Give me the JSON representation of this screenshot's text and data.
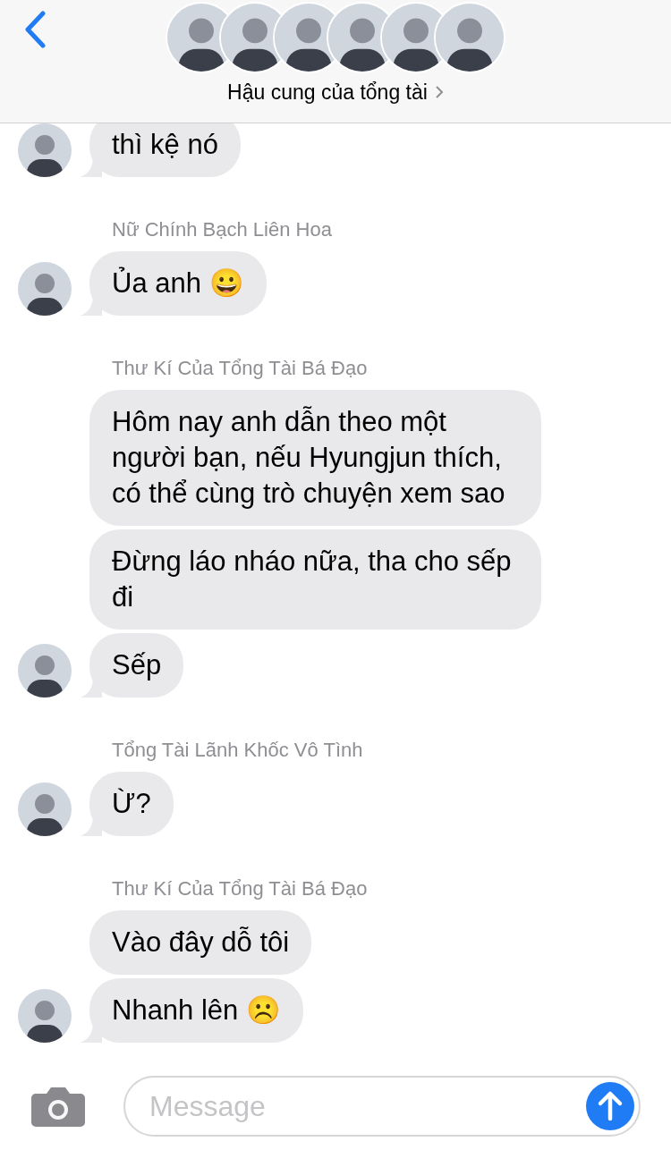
{
  "header": {
    "title": "Hậu cung của tổng tài"
  },
  "messages": [
    {
      "text": "thì kệ nó",
      "show_avatar": true
    },
    {
      "sender": "Nữ Chính Bạch Liên Hoa",
      "text": "Ủa anh 😀",
      "show_avatar": true
    },
    {
      "sender": "Thư Kí Của Tổng Tài Bá Đạo",
      "text": "Hôm nay anh dẫn theo một người bạn, nếu Hyungjun thích, có thể cùng trò chuyện xem sao",
      "show_avatar": false
    },
    {
      "text": "Đừng láo nháo nữa, tha cho sếp đi",
      "show_avatar": false
    },
    {
      "text": "Sếp",
      "show_avatar": true
    },
    {
      "sender": "Tổng Tài Lãnh Khốc Vô Tình",
      "text": "Ừ?",
      "show_avatar": true
    },
    {
      "sender": "Thư Kí Của Tổng Tài Bá Đạo",
      "text": "Vào đây dỗ tôi",
      "show_avatar": false
    },
    {
      "text": "Nhanh lên ☹️",
      "show_avatar": true
    }
  ],
  "composer": {
    "placeholder": "Message"
  }
}
